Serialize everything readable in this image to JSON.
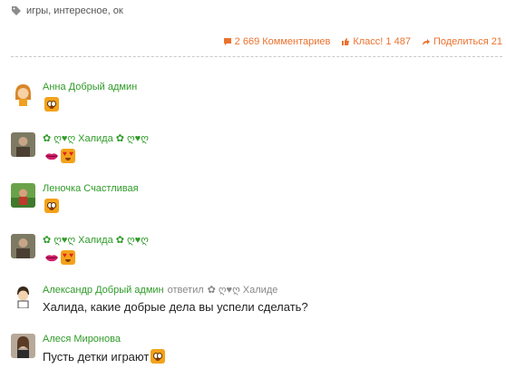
{
  "tags": {
    "text": "игры, интересное, ок"
  },
  "stats": {
    "comments": "2 669 Комментариев",
    "likes": "Класс! 1 487",
    "shares": "Поделиться 21"
  },
  "colors": {
    "accent": "#eb722e",
    "author": "#2f9b28"
  },
  "comments": [
    {
      "author": "Анна Добрый админ",
      "text": "",
      "emoji": [
        "smile-face"
      ]
    },
    {
      "author": "✿ ღ♥ღ Халида ✿ ღ♥ღ",
      "text": "",
      "emoji": [
        "lips",
        "heart-eyes-face"
      ]
    },
    {
      "author": "Леночка Счастливая",
      "text": "",
      "emoji": [
        "smile-face"
      ]
    },
    {
      "author": "✿ ღ♥ღ Халида ✿ ღ♥ღ",
      "text": "",
      "emoji": [
        "lips",
        "heart-eyes-face"
      ]
    },
    {
      "author": "Александр Добрый админ",
      "reply_word": "ответил",
      "reply_to": "✿ ღ♥ღ Халиде",
      "text": "Халида, какие добрые дела вы успели сделать?"
    },
    {
      "author": "Алеся Миронова",
      "text": "Пусть детки играют",
      "emoji": [
        "smile-face"
      ]
    }
  ]
}
